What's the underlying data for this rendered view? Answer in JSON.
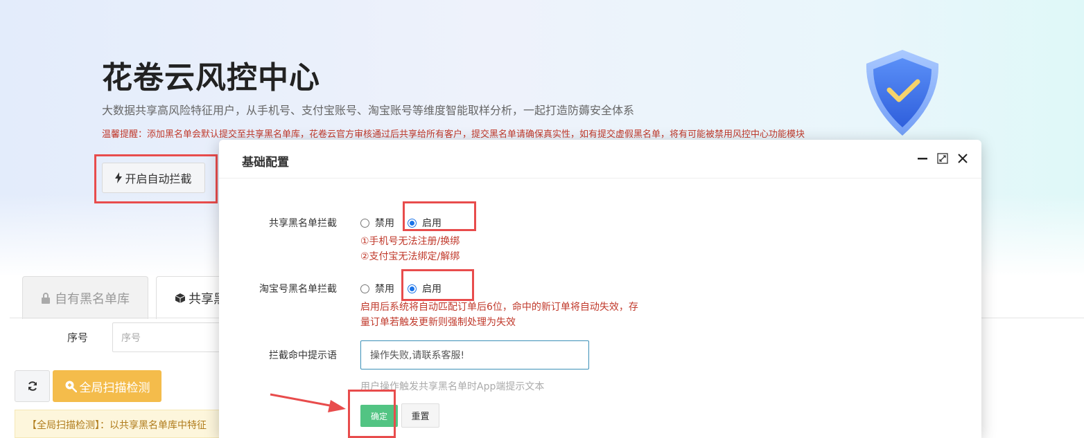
{
  "hero": {
    "title": "花卷云风控中心",
    "subtitle": "大数据共享高风险特征用户，从手机号、支付宝账号、淘宝账号等维度智能取样分析，一起打造防薅安全体系",
    "warning": "温馨提醒：添加黑名单会默认提交至共享黑名单库，花卷云官方审核通过后共享给所有客户，提交黑名单请确保真实性，如有提交虚假黑名单，将有可能被禁用风控中心功能模块",
    "auto_intercept_button": "开启自动拦截",
    "shield_icon": "shield-check-icon"
  },
  "tabs": [
    {
      "label": "自有黑名单库",
      "icon": "lock-icon"
    },
    {
      "label": "共享黑",
      "icon": "cube-icon"
    }
  ],
  "filter": {
    "serial_label": "序号",
    "serial_placeholder": "序号"
  },
  "toolbar": {
    "refresh_icon": "refresh-icon",
    "scan_button": "全局扫描检测",
    "scan_icon": "search-plus-icon"
  },
  "notice": "【全局扫描检测】：以共享黑名单库中特征",
  "modal": {
    "title": "基础配置",
    "controls": [
      "minimize-icon",
      "maximize-icon",
      "close-icon"
    ],
    "shared_blacklist": {
      "label": "共享黑名单拦截",
      "options": [
        "禁用",
        "启用"
      ],
      "selected": "启用",
      "hints": [
        "①手机号无法注册/换绑",
        "②支付宝无法绑定/解绑"
      ]
    },
    "taobao_blacklist": {
      "label": "淘宝号黑名单拦截",
      "options": [
        "禁用",
        "启用"
      ],
      "selected": "启用",
      "hint_line1": "启用后系统将自动匹配订单后6位，命中的新订单将自动失效，存",
      "hint_line2": "量订单若触发更新则强制处理为失效"
    },
    "prompt": {
      "label": "拦截命中提示语",
      "value": "操作失败,请联系客服!",
      "hint": "用户操作触发共享黑名单时App端提示文本"
    },
    "confirm_button": "确定",
    "reset_button": "重置"
  },
  "colors": {
    "accent_red": "#e84c4c",
    "confirm_green": "#52c483",
    "scan_orange": "#f4bc4b",
    "warning_text": "#c0392b"
  }
}
